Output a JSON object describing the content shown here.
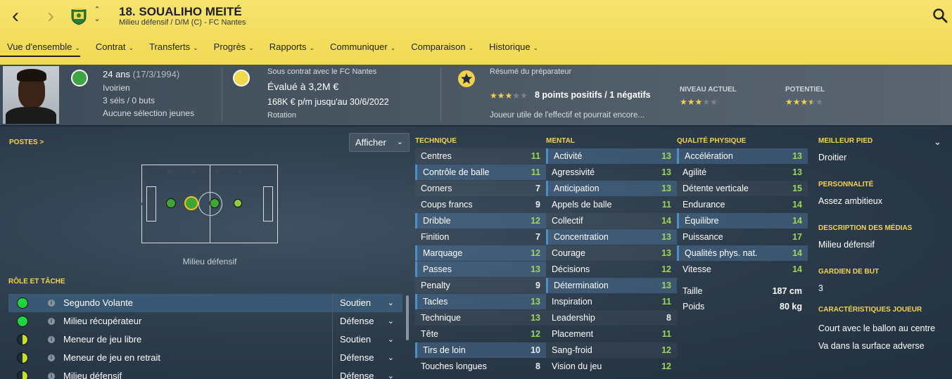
{
  "player": {
    "number_name": "18. SOUALIHO MEITÉ",
    "subtitle": "Milieu défensif / D/M (C) - FC Nantes"
  },
  "tabs": [
    {
      "label": "Vue d'ensemble"
    },
    {
      "label": "Contrat"
    },
    {
      "label": "Transferts"
    },
    {
      "label": "Progrès"
    },
    {
      "label": "Rapports"
    },
    {
      "label": "Communiquer"
    },
    {
      "label": "Comparaison"
    },
    {
      "label": "Historique"
    }
  ],
  "info": {
    "age": "24 ans",
    "dob": "(17/3/1994)",
    "nationality": "Ivoirien",
    "caps": "3 séls / 0 buts",
    "youth": "Aucune sélection jeunes",
    "contract_with": "Sous contrat avec le FC Nantes",
    "value": "Évalué à 3,2M €",
    "wage": "168K € p/m jusqu'au 30/6/2022",
    "status": "Rotation",
    "scout_title": "Résumé du préparateur",
    "scout_points": "8 points positifs / 1 négatifs",
    "scout_summary": "Joueur utile de l'effectif et pourrait encore...",
    "current_label": "NIVEAU ACTUEL",
    "potential_label": "POTENTIEL",
    "current_stars": 3,
    "potential_stars": 3.5,
    "scout_stars": 3
  },
  "positions": {
    "title": "POSTES >",
    "show_button": "Afficher",
    "pitch_label": "Milieu défensif"
  },
  "roles": {
    "title": "RÔLE ET TÂCHE",
    "items": [
      {
        "name": "Segundo Volante",
        "duty": "Soutien",
        "rating": "green"
      },
      {
        "name": "Milieu récupérateur",
        "duty": "Défense",
        "rating": "green"
      },
      {
        "name": "Meneur de jeu libre",
        "duty": "Soutien",
        "rating": "half"
      },
      {
        "name": "Meneur de jeu en retrait",
        "duty": "Défense",
        "rating": "half"
      },
      {
        "name": "Milieu défensif",
        "duty": "Défense",
        "rating": "half"
      }
    ]
  },
  "attributes": {
    "technique_title": "TECHNIQUE",
    "mental_title": "MENTAL",
    "physical_title": "QUALITÉ PHYSIQUE",
    "technique": [
      {
        "name": "Centres",
        "value": "11"
      },
      {
        "name": "Contrôle de balle",
        "value": "11"
      },
      {
        "name": "Corners",
        "value": "7"
      },
      {
        "name": "Coups francs",
        "value": "9"
      },
      {
        "name": "Dribble",
        "value": "12"
      },
      {
        "name": "Finition",
        "value": "7"
      },
      {
        "name": "Marquage",
        "value": "12"
      },
      {
        "name": "Passes",
        "value": "13"
      },
      {
        "name": "Penalty",
        "value": "9"
      },
      {
        "name": "Tacles",
        "value": "13"
      },
      {
        "name": "Technique",
        "value": "13"
      },
      {
        "name": "Tête",
        "value": "12"
      },
      {
        "name": "Tirs de loin",
        "value": "10"
      },
      {
        "name": "Touches longues",
        "value": "8"
      }
    ],
    "mental": [
      {
        "name": "Activité",
        "value": "13"
      },
      {
        "name": "Agressivité",
        "value": "13"
      },
      {
        "name": "Anticipation",
        "value": "13"
      },
      {
        "name": "Appels de balle",
        "value": "11"
      },
      {
        "name": "Collectif",
        "value": "14"
      },
      {
        "name": "Concentration",
        "value": "13"
      },
      {
        "name": "Courage",
        "value": "13"
      },
      {
        "name": "Décisions",
        "value": "12"
      },
      {
        "name": "Détermination",
        "value": "13"
      },
      {
        "name": "Inspiration",
        "value": "11"
      },
      {
        "name": "Leadership",
        "value": "8"
      },
      {
        "name": "Placement",
        "value": "11"
      },
      {
        "name": "Sang-froid",
        "value": "12"
      },
      {
        "name": "Vision du jeu",
        "value": "12"
      }
    ],
    "physical": [
      {
        "name": "Accélération",
        "value": "13"
      },
      {
        "name": "Agilité",
        "value": "13"
      },
      {
        "name": "Détente verticale",
        "value": "15"
      },
      {
        "name": "Endurance",
        "value": "14"
      },
      {
        "name": "Équilibre",
        "value": "14"
      },
      {
        "name": "Puissance",
        "value": "17"
      },
      {
        "name": "Qualités phys. nat.",
        "value": "14"
      },
      {
        "name": "Vitesse",
        "value": "14"
      }
    ],
    "height_label": "Taille",
    "height": "187 cm",
    "weight_label": "Poids",
    "weight": "80 kg"
  },
  "side": {
    "foot_title": "MEILLEUR PIED",
    "foot": "Droitier",
    "personality_title": "PERSONNALITÉ",
    "personality": "Assez ambitieux",
    "media_title": "DESCRIPTION DES MÉDIAS",
    "media": "Milieu défensif",
    "gk_title": "GARDIEN DE BUT",
    "gk": "3",
    "traits_title": "CARACTÉRISTIQUES JOUEUR",
    "traits": [
      "Court avec le ballon au centre",
      "Va dans la surface adverse"
    ]
  },
  "colors": {
    "accent_yellow": "#f1d954",
    "attr_green": "#9bd65a",
    "highlight_blue": "#3a5774"
  }
}
